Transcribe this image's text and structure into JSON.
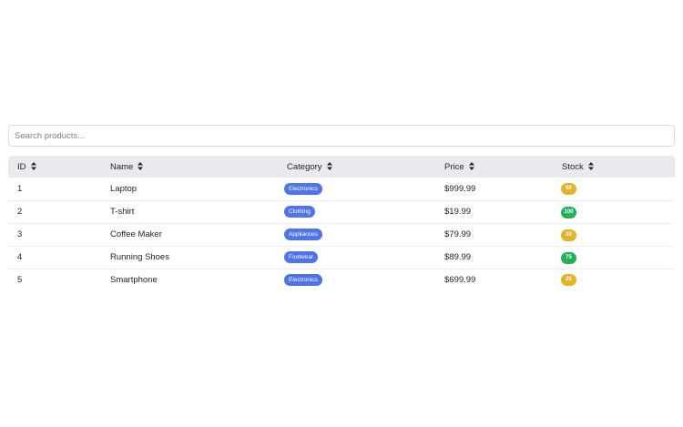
{
  "search": {
    "placeholder": "Search products..."
  },
  "table": {
    "columns": [
      "ID",
      "Name",
      "Category",
      "Price",
      "Stock"
    ],
    "rows": [
      {
        "id": "1",
        "name": "Laptop",
        "category": "Electronics",
        "price": "$999.99",
        "stock": "50",
        "stock_color": "#e3b32a"
      },
      {
        "id": "2",
        "name": "T-shirt",
        "category": "Clothing",
        "price": "$19.99",
        "stock": "100",
        "stock_color": "#22b15a"
      },
      {
        "id": "3",
        "name": "Coffee Maker",
        "category": "Appliances",
        "price": "$79.99",
        "stock": "30",
        "stock_color": "#e3b32a"
      },
      {
        "id": "4",
        "name": "Running Shoes",
        "category": "Footwear",
        "price": "$89.99",
        "stock": "75",
        "stock_color": "#22b15a"
      },
      {
        "id": "5",
        "name": "Smartphone",
        "category": "Electronics",
        "price": "$699.99",
        "stock": "25",
        "stock_color": "#e3b32a"
      }
    ]
  },
  "colors": {
    "category_badge": "#4f73e8",
    "stock_low": "#e3b32a",
    "stock_high": "#22b15a",
    "header_bg": "#e9eaee"
  },
  "icons": {
    "sort": "sort-icon"
  }
}
